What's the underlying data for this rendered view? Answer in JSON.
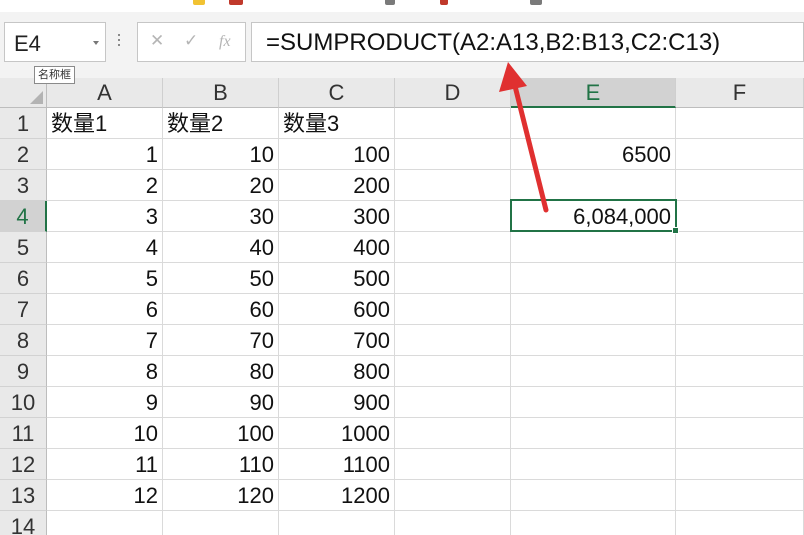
{
  "namebox": {
    "value": "E4",
    "tooltip": "名称框"
  },
  "formula_bar": {
    "cancel_icon": "close-icon",
    "enter_icon": "check-icon",
    "function_icon": "fx-icon",
    "formula": "=SUMPRODUCT(A2:A13,B2:B13,C2:C13)"
  },
  "columns": [
    "A",
    "B",
    "C",
    "D",
    "E",
    "F"
  ],
  "selected_column": "E",
  "selected_row": "4",
  "rows": [
    {
      "num": "1",
      "A": "数量1",
      "B": "数量2",
      "C": "数量3",
      "E": ""
    },
    {
      "num": "2",
      "A": "1",
      "B": "10",
      "C": "100",
      "E": "6500"
    },
    {
      "num": "3",
      "A": "2",
      "B": "20",
      "C": "200",
      "E": ""
    },
    {
      "num": "4",
      "A": "3",
      "B": "30",
      "C": "300",
      "E": "6,084,000"
    },
    {
      "num": "5",
      "A": "4",
      "B": "40",
      "C": "400",
      "E": ""
    },
    {
      "num": "6",
      "A": "5",
      "B": "50",
      "C": "500",
      "E": ""
    },
    {
      "num": "7",
      "A": "6",
      "B": "60",
      "C": "600",
      "E": ""
    },
    {
      "num": "8",
      "A": "7",
      "B": "70",
      "C": "700",
      "E": ""
    },
    {
      "num": "9",
      "A": "8",
      "B": "80",
      "C": "800",
      "E": ""
    },
    {
      "num": "10",
      "A": "9",
      "B": "90",
      "C": "900",
      "E": ""
    },
    {
      "num": "11",
      "A": "10",
      "B": "100",
      "C": "1000",
      "E": ""
    },
    {
      "num": "12",
      "A": "11",
      "B": "110",
      "C": "1100",
      "E": ""
    },
    {
      "num": "13",
      "A": "12",
      "B": "120",
      "C": "1200",
      "E": ""
    },
    {
      "num": "14",
      "A": "",
      "B": "",
      "C": "",
      "E": ""
    }
  ],
  "colors": {
    "selection": "#217346",
    "annotation_arrow": "#e03030"
  }
}
